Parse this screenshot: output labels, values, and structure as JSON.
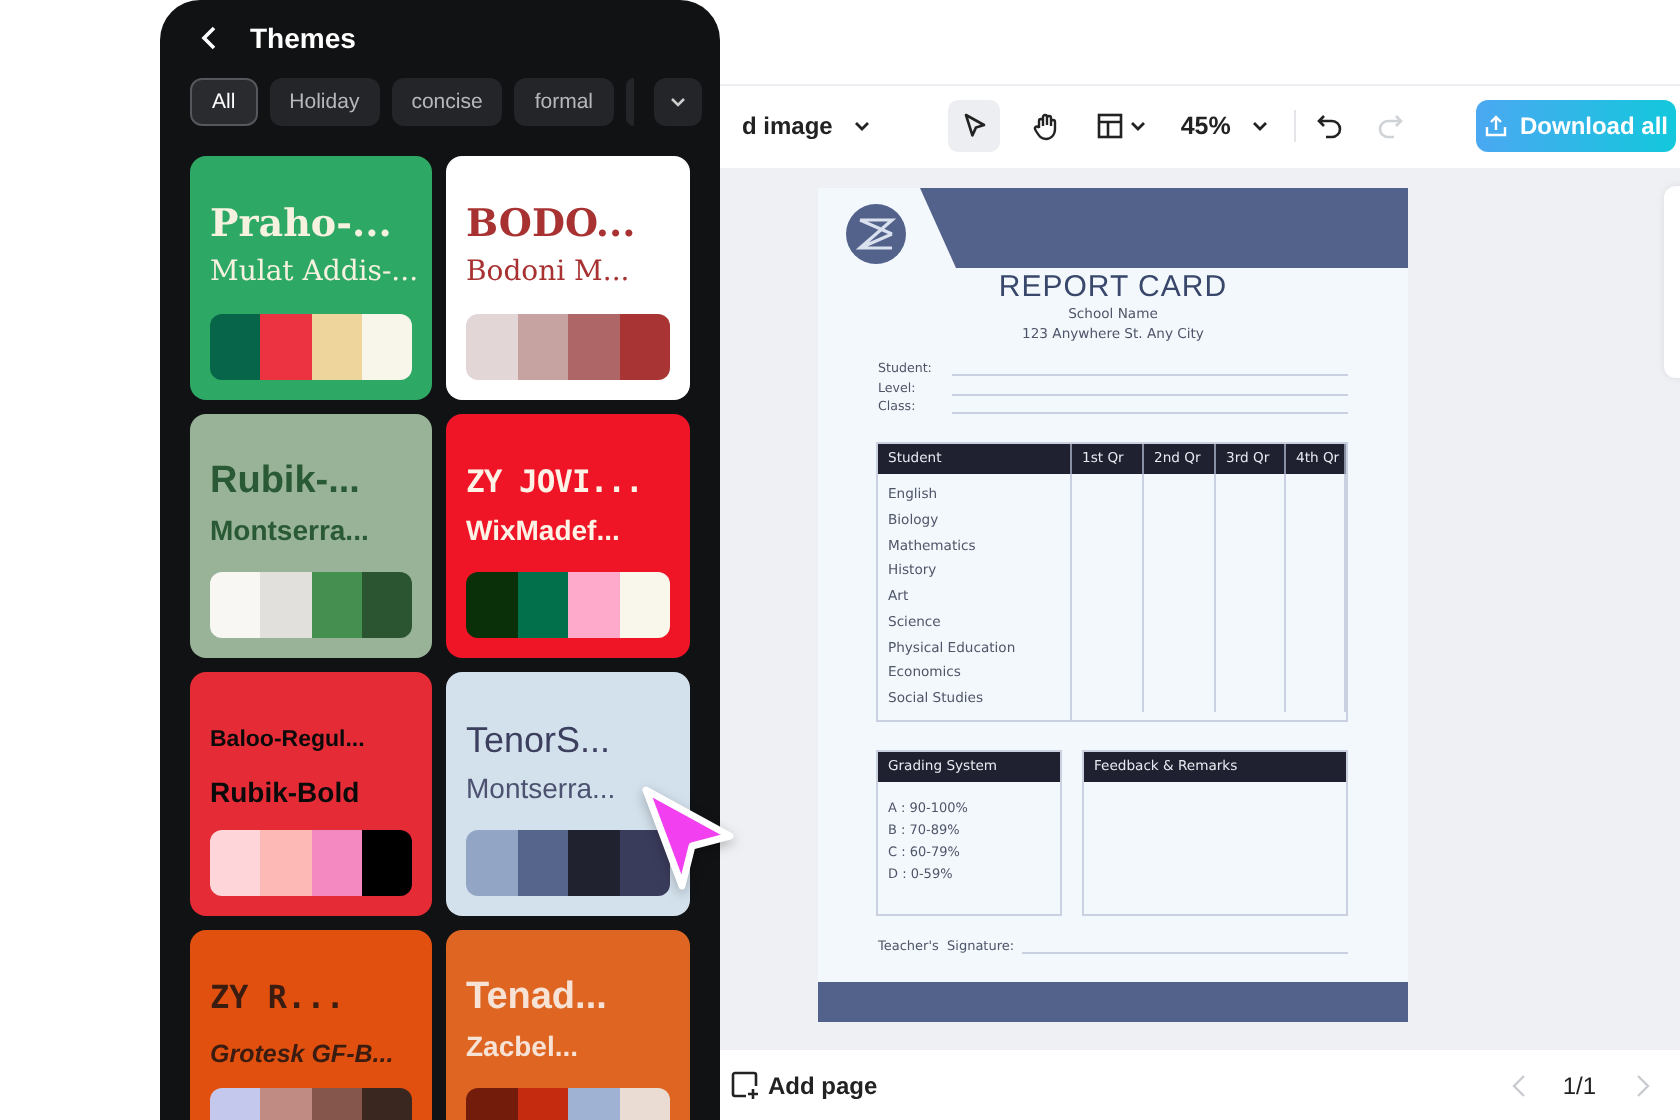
{
  "themes_panel": {
    "title": "Themes",
    "filters": [
      {
        "label": "All",
        "selected": true
      },
      {
        "label": "Holiday",
        "selected": false
      },
      {
        "label": "concise",
        "selected": false
      },
      {
        "label": "formal",
        "selected": false
      }
    ],
    "themes": [
      {
        "kind": "serif",
        "color": "#2ea865",
        "title": {
          "text": "Praho-...",
          "color": "#f7f2e0"
        },
        "subtitle": {
          "text": "Mulat Addis-...",
          "color": "#f7f2e0"
        },
        "palette": [
          {
            "color": "#07664a"
          },
          {
            "color": "#ec3342"
          },
          {
            "color": "#edd59b"
          },
          {
            "color": "#f8f6ea"
          }
        ]
      },
      {
        "kind": "serif",
        "color": "#ffffff",
        "title": {
          "text": "BODO...",
          "color": "#a83232"
        },
        "subtitle": {
          "text": "Bodoni M...",
          "color": "#a83232"
        },
        "palette": [
          {
            "color": "#e2d6d6"
          },
          {
            "color": "#c6a3a1"
          },
          {
            "color": "#ae6766"
          },
          {
            "color": "#a83434"
          }
        ]
      },
      {
        "kind": "sans",
        "color": "#98b398",
        "title": {
          "text": "Rubik-...",
          "color": "#2a5a35"
        },
        "subtitle": {
          "text": "Montserra...",
          "color": "#2a5a35"
        },
        "palette": [
          {
            "color": "#f8f7f4"
          },
          {
            "color": "#e1e0dd"
          },
          {
            "color": "#458f50"
          },
          {
            "color": "#2a5530"
          }
        ]
      },
      {
        "kind": "mono",
        "color": "#ef1526",
        "title": {
          "text": "ZY JOVI...",
          "color": "#fdf2e6"
        },
        "subtitle": {
          "text": "WixMadef...",
          "color": "#fdf2e6"
        },
        "palette": [
          {
            "color": "#093009"
          },
          {
            "color": "#03704c"
          },
          {
            "color": "#fdaacb"
          },
          {
            "color": "#f9f6ec"
          }
        ]
      },
      {
        "kind": "small",
        "color": "#e52c36",
        "title": {
          "text": "Baloo-Regul...",
          "color": "#0a0a0a"
        },
        "subtitle": {
          "text": "Rubik-Bold",
          "color": "#0a0a0a"
        },
        "palette": [
          {
            "color": "#fed6da"
          },
          {
            "color": "#fdb9b5"
          },
          {
            "color": "#f488c0"
          },
          {
            "color": "#000000"
          }
        ]
      },
      {
        "kind": "light",
        "color": "#d3e1ec",
        "title": {
          "text": "TenorS...",
          "color": "#3c3f5e"
        },
        "subtitle": {
          "text": "Montserra...",
          "color": "#4d5270"
        },
        "palette": [
          {
            "color": "#92a5c5"
          },
          {
            "color": "#55658c"
          },
          {
            "color": "#20222f"
          },
          {
            "color": "#3a3c5c"
          }
        ]
      },
      {
        "kind": "italic",
        "color": "#e2500f",
        "title": {
          "text": "ZY R...",
          "color": "#3a1c10"
        },
        "subtitle": {
          "text": "Grotesk GF-B...",
          "color": "#3a1c10"
        },
        "palette": [
          {
            "color": "#c4c8ec"
          },
          {
            "color": "#bf8b83"
          },
          {
            "color": "#85564c"
          },
          {
            "color": "#3a2720"
          }
        ]
      },
      {
        "kind": "sans",
        "color": "#df6622",
        "title": {
          "text": "Tenad...",
          "color": "#f7e2d6"
        },
        "subtitle": {
          "text": "Zacbel...",
          "color": "#f7e2d6"
        },
        "palette": [
          {
            "color": "#741c0c"
          },
          {
            "color": "#c42b0f"
          },
          {
            "color": "#9fb2d4"
          },
          {
            "color": "#eadbd3"
          }
        ]
      }
    ]
  },
  "toolbar": {
    "image_menu": "d image",
    "zoom": "45%",
    "redo_disabled": true,
    "download": "Download all"
  },
  "document": {
    "title": "REPORT CARD",
    "school": "School Name",
    "address": "123 Anywhere St. Any City",
    "fields": [
      "Student:",
      "Level:",
      "Class:"
    ],
    "columns": [
      "Student",
      "1st Qr",
      "2nd Qr",
      "3rd Qr",
      "4th Qr"
    ],
    "subjects": [
      "English",
      "Biology",
      "Mathematics",
      "History",
      "Art",
      "Science",
      "Physical Education",
      "Economics",
      "Social Studies"
    ],
    "grading_title": "Grading System",
    "grades": [
      "A : 90-100%",
      "B : 70-89%",
      "C : 60-79%",
      "D : 0-59%"
    ],
    "feedback_title": "Feedback & Remarks",
    "signature": "Teacher's  Signature:"
  },
  "footer": {
    "add_page": "Add page",
    "page": "1/1"
  }
}
